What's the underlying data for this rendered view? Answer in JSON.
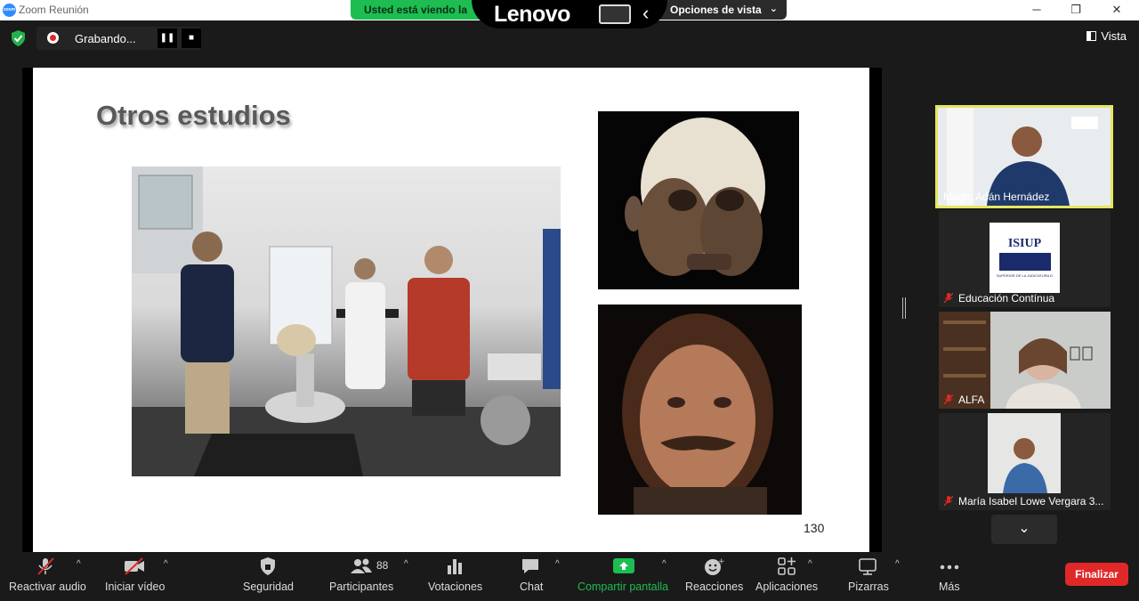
{
  "window": {
    "title": "Zoom Reunión",
    "logo_text": "zoom"
  },
  "share_banner": {
    "status": "Usted está viendo la",
    "options": "Opciones de vista",
    "brand": "Lenovo"
  },
  "recording": {
    "label": "Grabando..."
  },
  "view": {
    "label": "Vista"
  },
  "slide": {
    "title": "Otros estudios",
    "page_number": "130"
  },
  "participants": [
    {
      "name": "Magtr. Adán Hernádez",
      "muted": false,
      "active": true
    },
    {
      "name": "Educación Contínua",
      "muted": true,
      "logo_text": "ISIUP",
      "logo_subtext": "SUPERIOR DE LA JUDICATURA D"
    },
    {
      "name": "ALFA",
      "muted": true
    },
    {
      "name": "María Isabel Lowe Vergara 3...",
      "muted": true
    }
  ],
  "toolbar": {
    "audio": "Reactivar audio",
    "video": "Iniciar vídeo",
    "security": "Seguridad",
    "participants": "Participantes",
    "participants_count": "88",
    "polls": "Votaciones",
    "chat": "Chat",
    "share": "Compartir pantalla",
    "reactions": "Reacciones",
    "apps": "Aplicaciones",
    "whiteboards": "Pizarras",
    "more": "Más",
    "end": "Finalizar"
  },
  "colors": {
    "share_green": "#1dbd52",
    "end_red": "#e02828",
    "active_border": "#e5e55f",
    "toolbar_bg": "#1a1a1a"
  }
}
